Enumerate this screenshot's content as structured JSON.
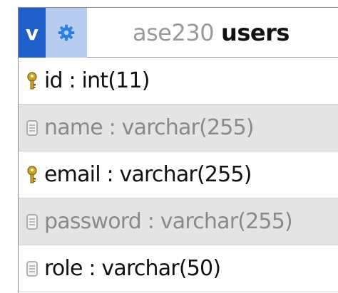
{
  "header": {
    "v_button_label": "v",
    "database": "ase230",
    "table": "users"
  },
  "columns": [
    {
      "text": "id : int(11)",
      "key_type": "primary",
      "icon": "key-icon"
    },
    {
      "text": "name : varchar(255)",
      "key_type": "none",
      "icon": "column-icon"
    },
    {
      "text": "email : varchar(255)",
      "key_type": "unique",
      "icon": "key-icon"
    },
    {
      "text": "password : varchar(255)",
      "key_type": "none",
      "icon": "column-icon"
    },
    {
      "text": "role : varchar(50)",
      "key_type": "none",
      "icon": "column-icon"
    }
  ],
  "colors": {
    "v_button_bg": "#1f5fc7",
    "gear_button_bg": "#b6cdef",
    "gear_icon": "#2e7fe0",
    "alt_row_bg": "#e4e4e4",
    "key_gold": "#c9a227",
    "column_icon_gray": "#9a9a9a"
  }
}
